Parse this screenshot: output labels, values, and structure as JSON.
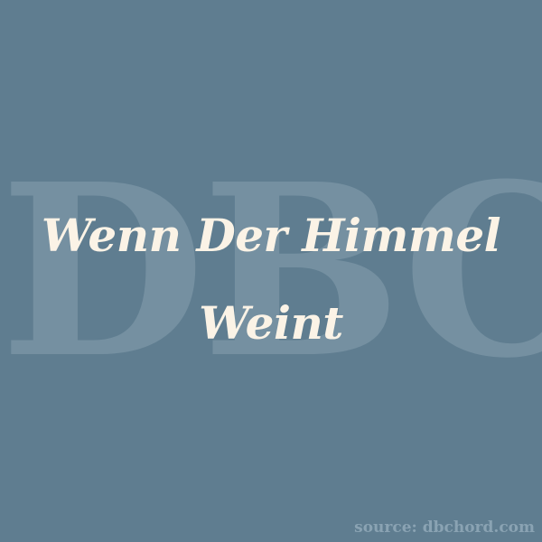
{
  "watermark": {
    "text": "DBC"
  },
  "title": {
    "text": "Wenn Der Himmel Weint"
  },
  "source": {
    "text": "source: dbchord.com"
  },
  "colors": {
    "background": "#5f7d90",
    "watermark": "#7590a1",
    "title": "#fbf3e6",
    "source": "#8aa3b3"
  }
}
